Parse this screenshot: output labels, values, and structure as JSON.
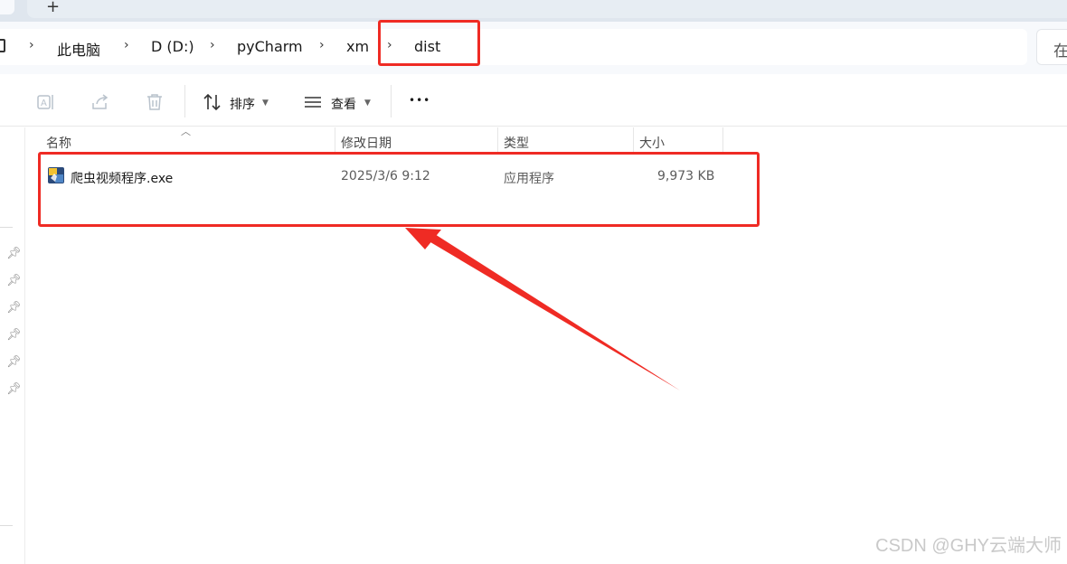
{
  "tabs": {
    "close_glyph": "×",
    "add_glyph": "+"
  },
  "breadcrumb": {
    "items": [
      "此电脑",
      "D (D:)",
      "pyCharm",
      "xm",
      "dist"
    ],
    "separator": "›",
    "search_partial": "在"
  },
  "commandbar": {
    "sort_label": "排序",
    "view_label": "查看",
    "more_label": "•••"
  },
  "columns": {
    "name": "名称",
    "modified": "修改日期",
    "type": "类型",
    "size": "大小"
  },
  "files": [
    {
      "name": "爬虫视频程序.exe",
      "modified": "2025/3/6 9:12",
      "type": "应用程序",
      "size": "9,973 KB",
      "icon": "exe-app-icon"
    }
  ],
  "annotation": {
    "color": "#ef2b24"
  },
  "watermark": "CSDN @GHY云端大师"
}
